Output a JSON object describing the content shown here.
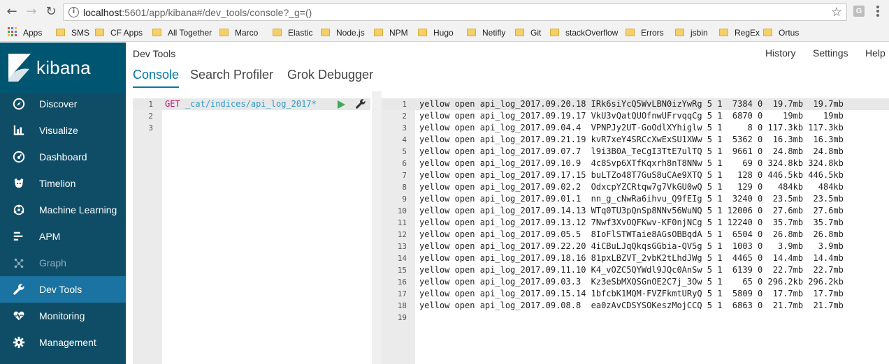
{
  "browser": {
    "url_host": "localhost",
    "url_rest": ":5601/app/kibana#/dev_tools/console?_g=()",
    "ext_label": "G",
    "bookmarks": [
      "Apps",
      "SMS",
      "CF Apps",
      "All Together",
      "Marco",
      "Elastic",
      "Node.js",
      "NPM",
      "Hugo",
      "Netifly",
      "Git",
      "stackOverflow",
      "Errors",
      "jsbin",
      "RegEx",
      "Ortus"
    ]
  },
  "sidebar": {
    "logo_text": "kibana",
    "items": [
      {
        "label": "Discover",
        "icon": "compass-icon"
      },
      {
        "label": "Visualize",
        "icon": "bar-chart-icon"
      },
      {
        "label": "Dashboard",
        "icon": "dashboard-icon"
      },
      {
        "label": "Timelion",
        "icon": "timelion-icon"
      },
      {
        "label": "Machine Learning",
        "icon": "machine-learning-icon"
      },
      {
        "label": "APM",
        "icon": "apm-icon"
      },
      {
        "label": "Graph",
        "icon": "graph-icon"
      },
      {
        "label": "Dev Tools",
        "icon": "wrench-icon"
      },
      {
        "label": "Monitoring",
        "icon": "heartbeat-icon"
      },
      {
        "label": "Management",
        "icon": "gear-icon"
      }
    ]
  },
  "header": {
    "title": "Dev Tools",
    "links": [
      "History",
      "Settings",
      "Help"
    ],
    "tabs": [
      "Console",
      "Search Profiler",
      "Grok Debugger"
    ]
  },
  "request": {
    "method": "GET",
    "path": "_cat/indices/api_log_2017*",
    "line_numbers": [
      "1",
      "2",
      "3"
    ]
  },
  "response": {
    "lines": [
      "yellow open api_log_2017.09.20.18 IRk6siYcQ5WvLBN0izYwRg 5 1  7384 0  19.7mb  19.7mb",
      "yellow open api_log_2017.09.19.17 VkU3vQatQUOfnwUFrvqqCg 5 1  6870 0    19mb    19mb",
      "yellow open api_log_2017.09.04.4  VPNPJy2UT-GoOdlXYhiglw 5 1     8 0 117.3kb 117.3kb",
      "yellow open api_log_2017.09.21.19 kvR7xeY4SRCcXwExSU1XWw 5 1  5362 0  16.3mb  16.3mb",
      "yellow open api_log_2017.09.07.7  l9i3B0A_TeCgI3TtE7ulTQ 5 1  9661 0  24.8mb  24.8mb",
      "yellow open api_log_2017.09.10.9  4c8Svp6XTfKqxrh8nT8NNw 5 1    69 0 324.8kb 324.8kb",
      "yellow open api_log_2017.09.17.15 buLTZo48T7GuS8uCAe9XTQ 5 1   128 0 446.5kb 446.5kb",
      "yellow open api_log_2017.09.02.2  OdxcpYZCRtqw7g7VkGU0wQ 5 1   129 0   484kb   484kb",
      "yellow open api_log_2017.09.01.1  nn_g_cNwRa6ihvu_Q9fEIg 5 1  3240 0  23.5mb  23.5mb",
      "yellow open api_log_2017.09.14.13 WTq0TU3pQnSp8NNv56WuNQ 5 1 12006 0  27.6mb  27.6mb",
      "yellow open api_log_2017.09.13.12 7Nwf3XvOQFKwv-KF0njNCg 5 1 12240 0  35.7mb  35.7mb",
      "yellow open api_log_2017.09.05.5  8IoFlSTWTaie8AGsOBBqdA 5 1  6504 0  26.8mb  26.8mb",
      "yellow open api_log_2017.09.22.20 4iCBuLJqQkqsGGbia-QV5g 5 1  1003 0   3.9mb   3.9mb",
      "yellow open api_log_2017.09.18.16 81pxLBZVT_2vbK2tLhdJWg 5 1  4465 0  14.4mb  14.4mb",
      "yellow open api_log_2017.09.11.10 K4_vOZC5QYWdl9JQc0AnSw 5 1  6139 0  22.7mb  22.7mb",
      "yellow open api_log_2017.09.03.3  Kz3eSbMXQSGnOE2C7j_3Ow 5 1    65 0 296.2kb 296.2kb",
      "yellow open api_log_2017.09.15.14 1bfcbK1MQM-FVZFkmtURyQ 5 1  5809 0  17.7mb  17.7mb",
      "yellow open api_log_2017.09.08.8  ea0zAvCDSYSOKeszMojCCQ 5 1  6863 0  21.7mb  21.7mb",
      ""
    ]
  }
}
